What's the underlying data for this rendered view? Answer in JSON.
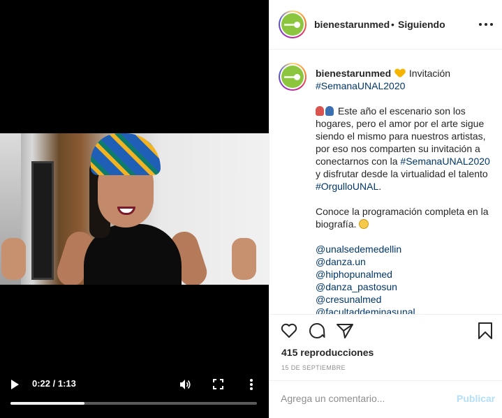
{
  "video": {
    "current_time": "0:22",
    "duration": "1:13",
    "time_separator": " / ",
    "progress_fraction": 0.3,
    "icons": [
      "play-icon",
      "volume-icon",
      "fullscreen-icon",
      "more-vertical-icon"
    ]
  },
  "header": {
    "username": "bienestarunmed",
    "dot": "•",
    "follow_status": "Siguiendo",
    "more_icon": "more-horizontal-icon"
  },
  "caption": {
    "username": "bienestarunmed",
    "title_word": "Invitación",
    "hashtag_top": "#SemanaUNAL2020",
    "p1_part1": " Este año el escenario son los hogares, pero el amor por el arte sigue siendo el mismo para nuestros artistas, por eso nos comparten su invitación a conectarnos con la ",
    "p1_hashtag1": "#SemanaUNAL2020",
    "p1_part2": " y disfrutar desde la virtualidad el talento ",
    "p1_hashtag2": "#OrgulloUNAL",
    "p1_end": ".",
    "p2": "Conoce la programación completa en la biografía. ",
    "mentions": [
      "@unalsedemedellin",
      "@danza.un",
      "@hiphopunalmed",
      "@danza_pastosun",
      "@cresunalmed",
      "@facultaddeminasunal"
    ]
  },
  "actions": {
    "icons": [
      "heart-icon",
      "comment-icon",
      "share-icon",
      "bookmark-icon"
    ],
    "views": "415 reproducciones",
    "date": "15 DE SEPTIEMBRE"
  },
  "comment": {
    "placeholder": "Agrega un comentario...",
    "post_label": "Publicar"
  },
  "colors": {
    "link": "#00376b",
    "post_disabled": "#b2dffc",
    "avatar_green": "#8cc63f"
  }
}
